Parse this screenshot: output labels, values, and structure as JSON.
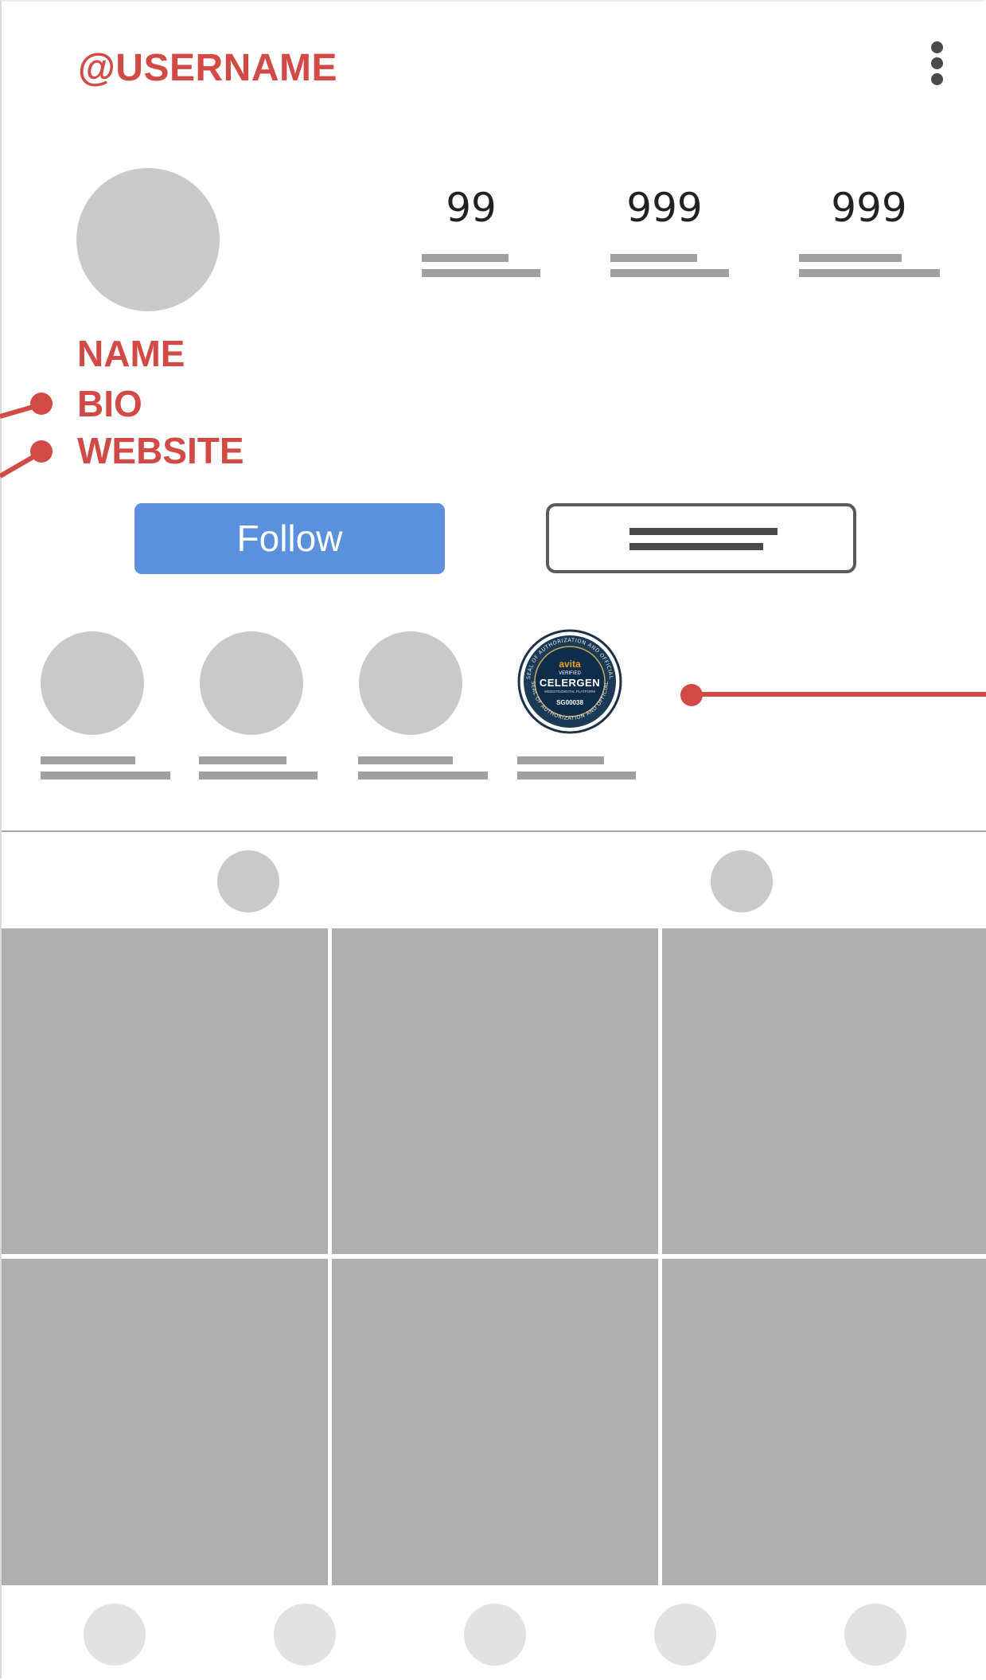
{
  "header": {
    "username": "@USERNAME",
    "menu_icon": "more-vertical-icon"
  },
  "stats": [
    {
      "value": "99"
    },
    {
      "value": "999"
    },
    {
      "value": "999"
    }
  ],
  "profile": {
    "name_label": "NAME",
    "bio_label": "BIO",
    "website_label": "WEBSITE"
  },
  "actions": {
    "follow_label": "Follow"
  },
  "highlights": {
    "badge": {
      "brand": "avita",
      "verified": "VERIFIED",
      "company": "CELERGEN",
      "sub": "WEBSITE/DIGITAL PLATFORM",
      "code": "SG00038",
      "ring_text": "SEAL OF AUTHORIZATION AND OFFICIAL"
    }
  },
  "tabs": {
    "icons": [
      "grid-icon",
      "tagged-icon"
    ]
  },
  "bottom_nav": {
    "icons": [
      "home-icon",
      "search-icon",
      "add-icon",
      "activity-icon",
      "profile-icon"
    ]
  },
  "colors": {
    "accent_red": "#d24a45",
    "follow_blue": "#5b91dc",
    "placeholder_gray": "#c9c9c9",
    "tile_gray": "#afafaf"
  }
}
